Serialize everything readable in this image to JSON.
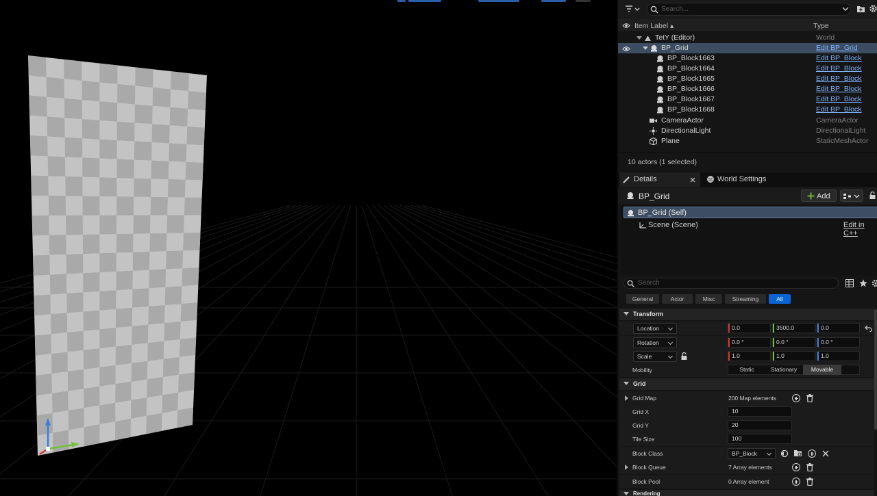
{
  "outliner": {
    "search_placeholder": "Search...",
    "col_item_label": "Item Label ▴",
    "col_type": "Type",
    "rows": [
      {
        "label": "TetY (Editor)",
        "type": "World",
        "link": false,
        "icon": "world-icon"
      },
      {
        "label": "BP_Grid",
        "type": "Edit BP_Grid",
        "link": true,
        "icon": "blueprint-actor-icon",
        "selected": true
      },
      {
        "label": "BP_Block1663",
        "type": "Edit BP_Block",
        "link": true,
        "icon": "blueprint-actor-icon"
      },
      {
        "label": "BP_Block1664",
        "type": "Edit BP_Block",
        "link": true,
        "icon": "blueprint-actor-icon"
      },
      {
        "label": "BP_Block1665",
        "type": "Edit BP_Block",
        "link": true,
        "icon": "blueprint-actor-icon"
      },
      {
        "label": "BP_Block1666",
        "type": "Edit BP_Block",
        "link": true,
        "icon": "blueprint-actor-icon"
      },
      {
        "label": "BP_Block1667",
        "type": "Edit BP_Block",
        "link": true,
        "icon": "blueprint-actor-icon"
      },
      {
        "label": "BP_Block1668",
        "type": "Edit BP_Block",
        "link": true,
        "icon": "blueprint-actor-icon"
      },
      {
        "label": "CameraActor",
        "type": "CameraActor",
        "link": false,
        "icon": "camera-icon"
      },
      {
        "label": "DirectionalLight",
        "type": "DirectionalLight",
        "link": false,
        "icon": "light-icon"
      },
      {
        "label": "Plane",
        "type": "StaticMeshActor",
        "link": false,
        "icon": "static-mesh-icon"
      }
    ],
    "actor_count": "10 actors (1 selected)"
  },
  "details": {
    "tab_details": "Details",
    "tab_world_settings": "World Settings",
    "actor_name": "BP_Grid",
    "add_label": "Add",
    "component_self": "BP_Grid (Self)",
    "component_scene": "Scene (Scene)",
    "edit_cpp": "Edit in C++",
    "search_placeholder": "Search",
    "filters": [
      "General",
      "Actor",
      "Misc",
      "Streaming",
      "All"
    ],
    "active_filter": "All",
    "transform": {
      "section": "Transform",
      "location_label": "Location",
      "location": [
        "0.0",
        "3500.0",
        "0.0"
      ],
      "rotation_label": "Rotation",
      "rotation": [
        "0.0 °",
        "0.0 °",
        "0.0 °"
      ],
      "scale_label": "Scale",
      "scale": [
        "1.0",
        "1.0",
        "1.0"
      ],
      "mobility_label": "Mobility",
      "mobility_options": [
        "Static",
        "Stationary",
        "Movable"
      ],
      "mobility_selected": "Movable"
    },
    "grid": {
      "section": "Grid",
      "grid_map_label": "Grid Map",
      "grid_map_value": "200 Map elements",
      "grid_x_label": "Grid X",
      "grid_x": "10",
      "grid_y_label": "Grid Y",
      "grid_y": "20",
      "tile_size_label": "Tile Size",
      "tile_size": "100",
      "block_class_label": "Block Class",
      "block_class": "BP_Block",
      "block_queue_label": "Block Queue",
      "block_queue_value": "7 Array elements",
      "block_pool_label": "Block Pool",
      "block_pool_value": "0 Array element"
    },
    "rendering_section": "Rendering"
  },
  "colors": {
    "accent_blue": "#0a64d6",
    "selection": "#3c4c61",
    "link": "#7fb3ff",
    "axis_x": "#d43a2a",
    "axis_y": "#6fc23a",
    "axis_z": "#3a7ee0"
  }
}
